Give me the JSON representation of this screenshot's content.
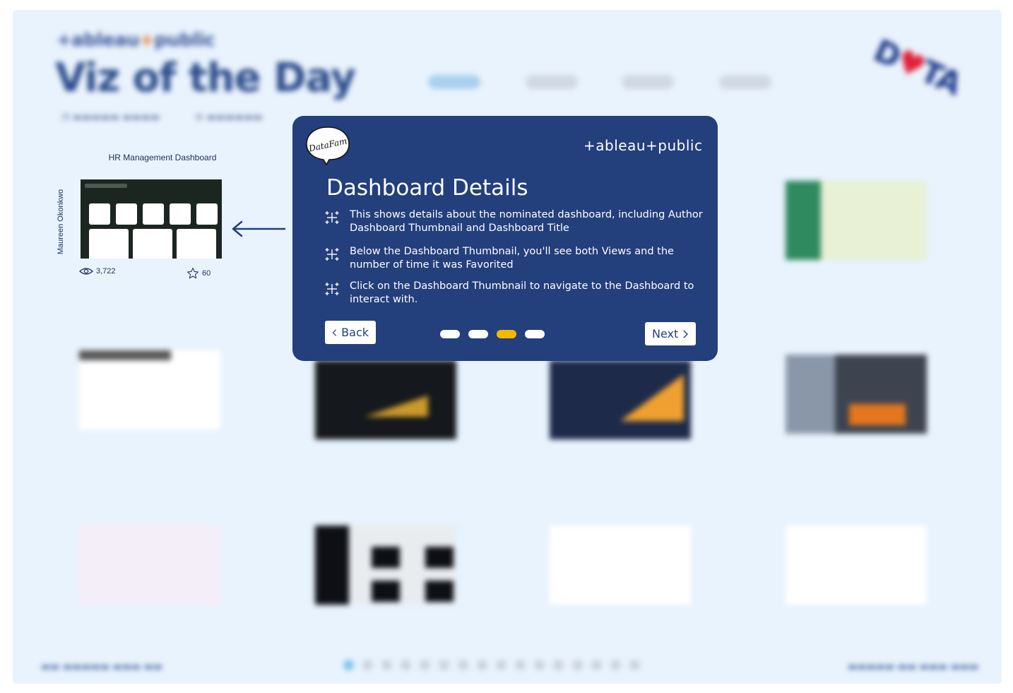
{
  "background": {
    "brand": "tableau public",
    "title": "Viz of the Day",
    "featured_card": {
      "title": "HR Management Dashboard",
      "author": "Maureen Okonkwo",
      "views": "3,722",
      "favorites": "60"
    }
  },
  "modal": {
    "datafam_logo": "DataFam",
    "tableau_logo": "+ableau+public",
    "title": "Dashboard Details",
    "items": [
      {
        "icon": "tableau-plus-icon",
        "text": "This shows details about the nominated dashboard, including Author Dashboard Thumbnail and Dashboard Title"
      },
      {
        "icon": "tableau-plus-icon",
        "text": "Below the Dashboard Thumbnail, you'll see both Views and the number of time it was Favorited"
      },
      {
        "icon": "tableau-plus-icon",
        "text": "Click on the Dashboard Thumbnail to navigate to the Dashboard to interact with."
      }
    ],
    "back_label": "Back",
    "next_label": "Next",
    "steps_total": 4,
    "current_step": 3,
    "colors": {
      "panel": "#233f7c",
      "active_step": "#f5b800"
    }
  }
}
